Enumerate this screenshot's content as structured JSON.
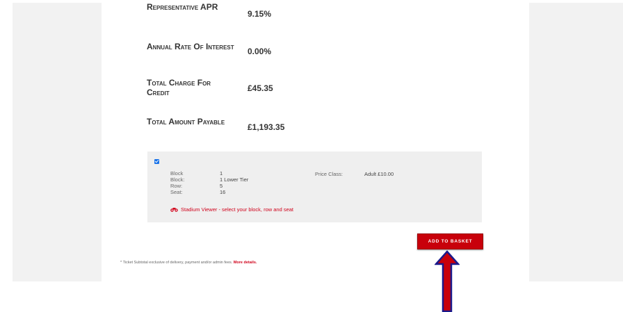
{
  "finance": {
    "apr": {
      "label": "Representative APR",
      "value": "9.15%"
    },
    "interest": {
      "label": "Annual Rate Of Interest",
      "value": "0.00%"
    },
    "charge": {
      "label": "Total Charge For Credit",
      "value": "£45.35"
    },
    "payable": {
      "label": "Total Amount Payable",
      "value": "£1,193.35"
    }
  },
  "ticket": {
    "rows": [
      {
        "label": "Block",
        "value": "1"
      },
      {
        "label": "Block:",
        "value": "1 Lower Tier"
      },
      {
        "label": "Row:",
        "value": "5"
      },
      {
        "label": "Seat:",
        "value": "16"
      }
    ],
    "price_class_label": "Price Class:",
    "price_class_value": "Adult £10.00",
    "stadium_link": "Stadium Viewer - select your block, row and seat",
    "icon": "binoculars-icon"
  },
  "add_to_basket": "Add to basket",
  "footnote": {
    "text": "* Ticket Subtotal exclusive of delivery, payment and/or admin fees. ",
    "link": "More details."
  },
  "colors": {
    "accent": "#c8000b",
    "arrow_fill": "#c8000b",
    "arrow_border": "#1a1a8c"
  }
}
